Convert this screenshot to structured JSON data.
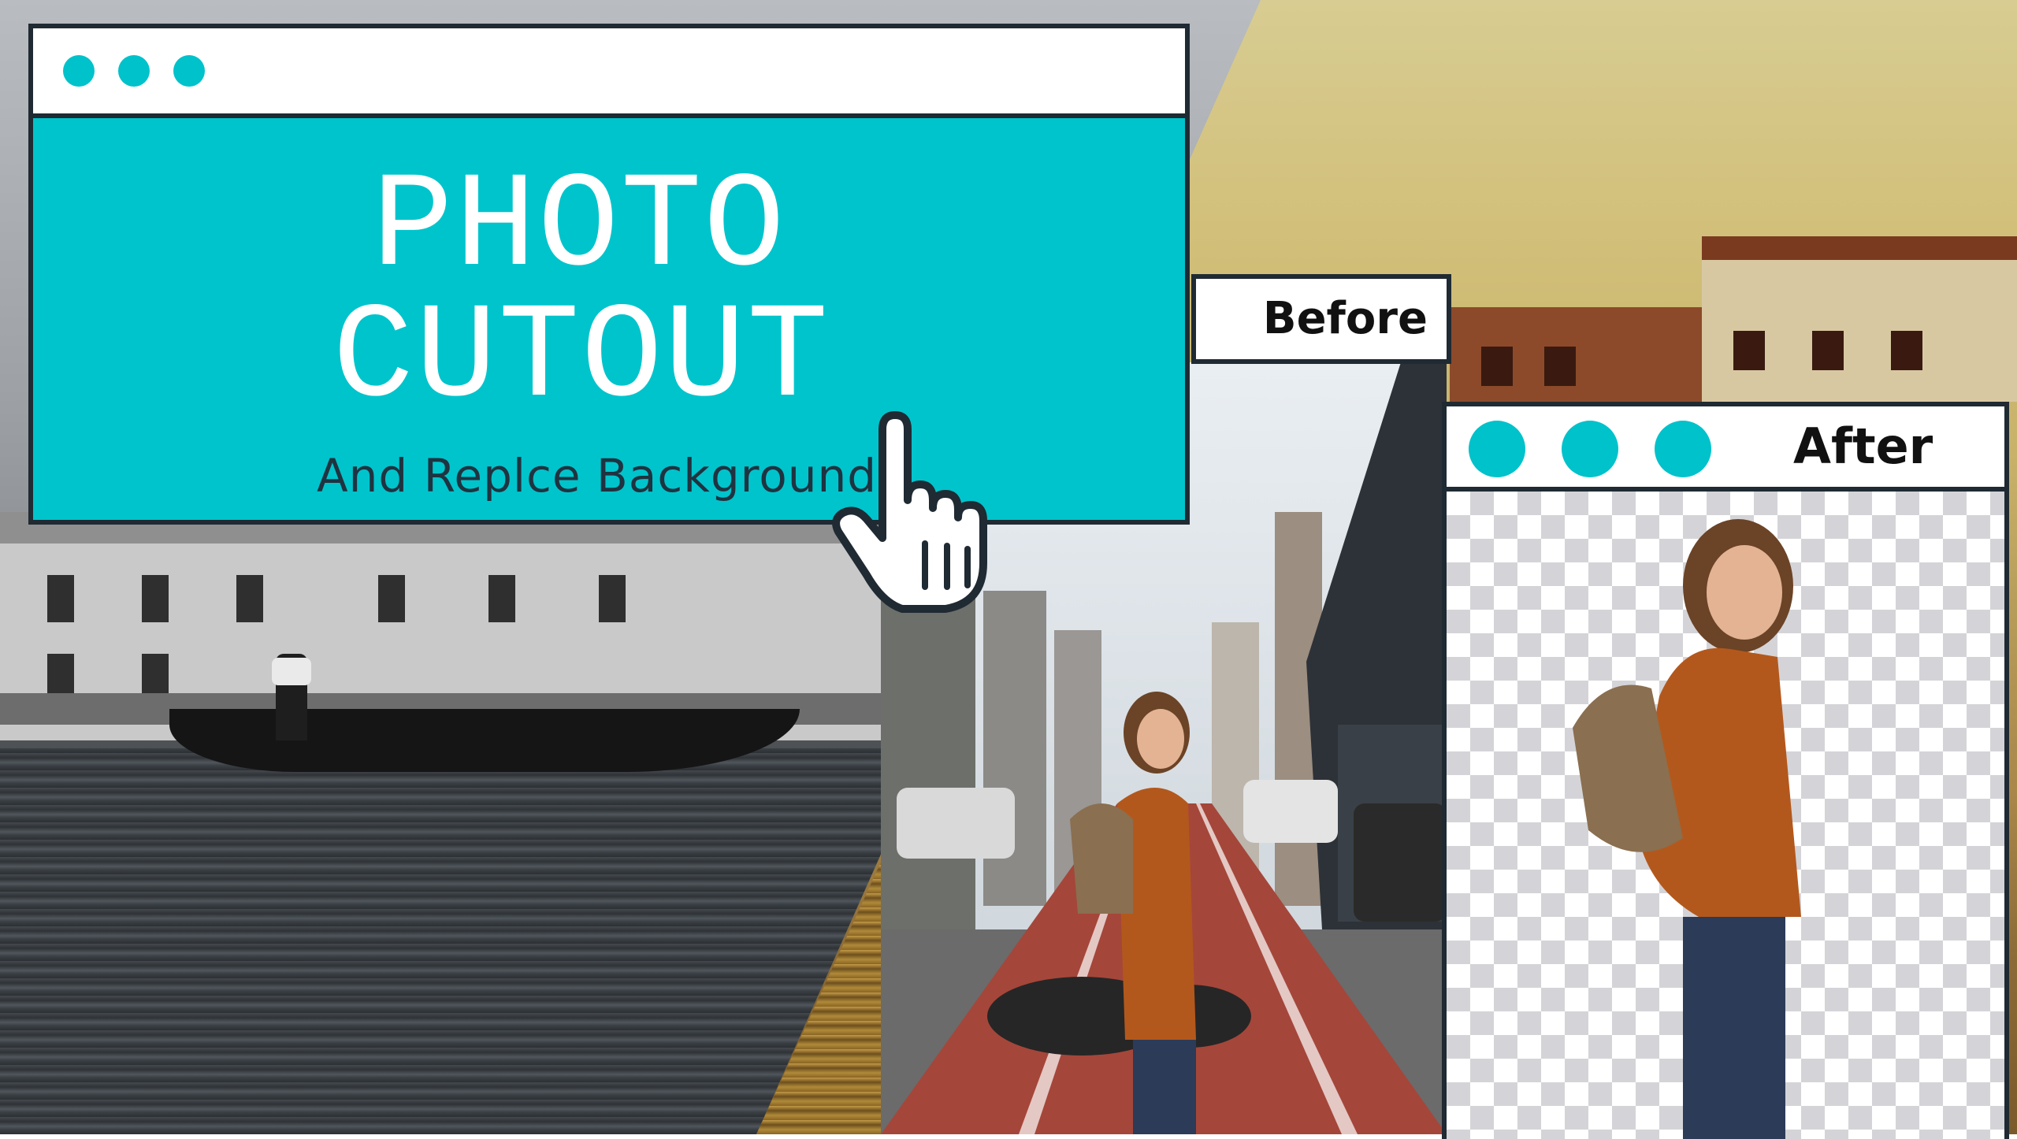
{
  "title_window": {
    "title_line1": "PHOTO",
    "title_line2": "CUTOUT",
    "subtitle": "And Replce Background"
  },
  "before_panel": {
    "label": "Before"
  },
  "after_panel": {
    "label": "After"
  },
  "colors": {
    "accent": "#00c4cc",
    "frame": "#1f2a33",
    "window_bar": "#ffffff"
  },
  "icons": [
    "window-dot-icon",
    "hand-pointer-cursor-icon"
  ]
}
